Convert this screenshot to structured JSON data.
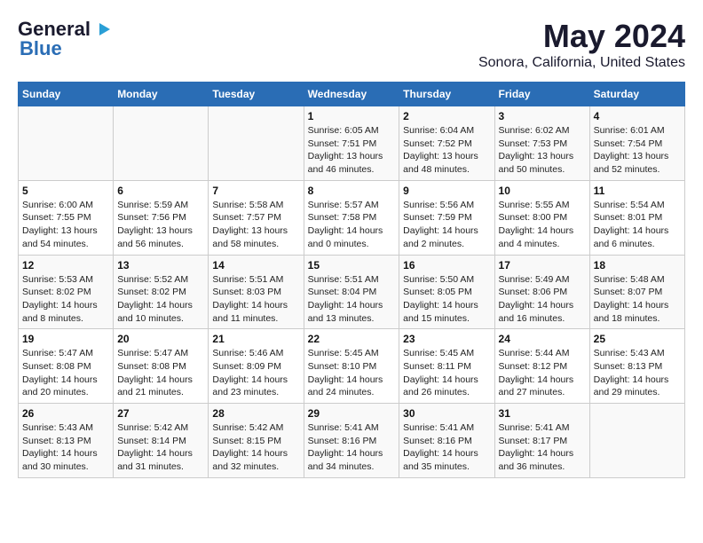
{
  "header": {
    "logo_line1": "General",
    "logo_line2": "Blue",
    "month": "May 2024",
    "location": "Sonora, California, United States"
  },
  "columns": [
    "Sunday",
    "Monday",
    "Tuesday",
    "Wednesday",
    "Thursday",
    "Friday",
    "Saturday"
  ],
  "weeks": [
    [
      {
        "day": "",
        "info": ""
      },
      {
        "day": "",
        "info": ""
      },
      {
        "day": "",
        "info": ""
      },
      {
        "day": "1",
        "info": "Sunrise: 6:05 AM\nSunset: 7:51 PM\nDaylight: 13 hours\nand 46 minutes."
      },
      {
        "day": "2",
        "info": "Sunrise: 6:04 AM\nSunset: 7:52 PM\nDaylight: 13 hours\nand 48 minutes."
      },
      {
        "day": "3",
        "info": "Sunrise: 6:02 AM\nSunset: 7:53 PM\nDaylight: 13 hours\nand 50 minutes."
      },
      {
        "day": "4",
        "info": "Sunrise: 6:01 AM\nSunset: 7:54 PM\nDaylight: 13 hours\nand 52 minutes."
      }
    ],
    [
      {
        "day": "5",
        "info": "Sunrise: 6:00 AM\nSunset: 7:55 PM\nDaylight: 13 hours\nand 54 minutes."
      },
      {
        "day": "6",
        "info": "Sunrise: 5:59 AM\nSunset: 7:56 PM\nDaylight: 13 hours\nand 56 minutes."
      },
      {
        "day": "7",
        "info": "Sunrise: 5:58 AM\nSunset: 7:57 PM\nDaylight: 13 hours\nand 58 minutes."
      },
      {
        "day": "8",
        "info": "Sunrise: 5:57 AM\nSunset: 7:58 PM\nDaylight: 14 hours\nand 0 minutes."
      },
      {
        "day": "9",
        "info": "Sunrise: 5:56 AM\nSunset: 7:59 PM\nDaylight: 14 hours\nand 2 minutes."
      },
      {
        "day": "10",
        "info": "Sunrise: 5:55 AM\nSunset: 8:00 PM\nDaylight: 14 hours\nand 4 minutes."
      },
      {
        "day": "11",
        "info": "Sunrise: 5:54 AM\nSunset: 8:01 PM\nDaylight: 14 hours\nand 6 minutes."
      }
    ],
    [
      {
        "day": "12",
        "info": "Sunrise: 5:53 AM\nSunset: 8:02 PM\nDaylight: 14 hours\nand 8 minutes."
      },
      {
        "day": "13",
        "info": "Sunrise: 5:52 AM\nSunset: 8:02 PM\nDaylight: 14 hours\nand 10 minutes."
      },
      {
        "day": "14",
        "info": "Sunrise: 5:51 AM\nSunset: 8:03 PM\nDaylight: 14 hours\nand 11 minutes."
      },
      {
        "day": "15",
        "info": "Sunrise: 5:51 AM\nSunset: 8:04 PM\nDaylight: 14 hours\nand 13 minutes."
      },
      {
        "day": "16",
        "info": "Sunrise: 5:50 AM\nSunset: 8:05 PM\nDaylight: 14 hours\nand 15 minutes."
      },
      {
        "day": "17",
        "info": "Sunrise: 5:49 AM\nSunset: 8:06 PM\nDaylight: 14 hours\nand 16 minutes."
      },
      {
        "day": "18",
        "info": "Sunrise: 5:48 AM\nSunset: 8:07 PM\nDaylight: 14 hours\nand 18 minutes."
      }
    ],
    [
      {
        "day": "19",
        "info": "Sunrise: 5:47 AM\nSunset: 8:08 PM\nDaylight: 14 hours\nand 20 minutes."
      },
      {
        "day": "20",
        "info": "Sunrise: 5:47 AM\nSunset: 8:08 PM\nDaylight: 14 hours\nand 21 minutes."
      },
      {
        "day": "21",
        "info": "Sunrise: 5:46 AM\nSunset: 8:09 PM\nDaylight: 14 hours\nand 23 minutes."
      },
      {
        "day": "22",
        "info": "Sunrise: 5:45 AM\nSunset: 8:10 PM\nDaylight: 14 hours\nand 24 minutes."
      },
      {
        "day": "23",
        "info": "Sunrise: 5:45 AM\nSunset: 8:11 PM\nDaylight: 14 hours\nand 26 minutes."
      },
      {
        "day": "24",
        "info": "Sunrise: 5:44 AM\nSunset: 8:12 PM\nDaylight: 14 hours\nand 27 minutes."
      },
      {
        "day": "25",
        "info": "Sunrise: 5:43 AM\nSunset: 8:13 PM\nDaylight: 14 hours\nand 29 minutes."
      }
    ],
    [
      {
        "day": "26",
        "info": "Sunrise: 5:43 AM\nSunset: 8:13 PM\nDaylight: 14 hours\nand 30 minutes."
      },
      {
        "day": "27",
        "info": "Sunrise: 5:42 AM\nSunset: 8:14 PM\nDaylight: 14 hours\nand 31 minutes."
      },
      {
        "day": "28",
        "info": "Sunrise: 5:42 AM\nSunset: 8:15 PM\nDaylight: 14 hours\nand 32 minutes."
      },
      {
        "day": "29",
        "info": "Sunrise: 5:41 AM\nSunset: 8:16 PM\nDaylight: 14 hours\nand 34 minutes."
      },
      {
        "day": "30",
        "info": "Sunrise: 5:41 AM\nSunset: 8:16 PM\nDaylight: 14 hours\nand 35 minutes."
      },
      {
        "day": "31",
        "info": "Sunrise: 5:41 AM\nSunset: 8:17 PM\nDaylight: 14 hours\nand 36 minutes."
      },
      {
        "day": "",
        "info": ""
      }
    ]
  ]
}
